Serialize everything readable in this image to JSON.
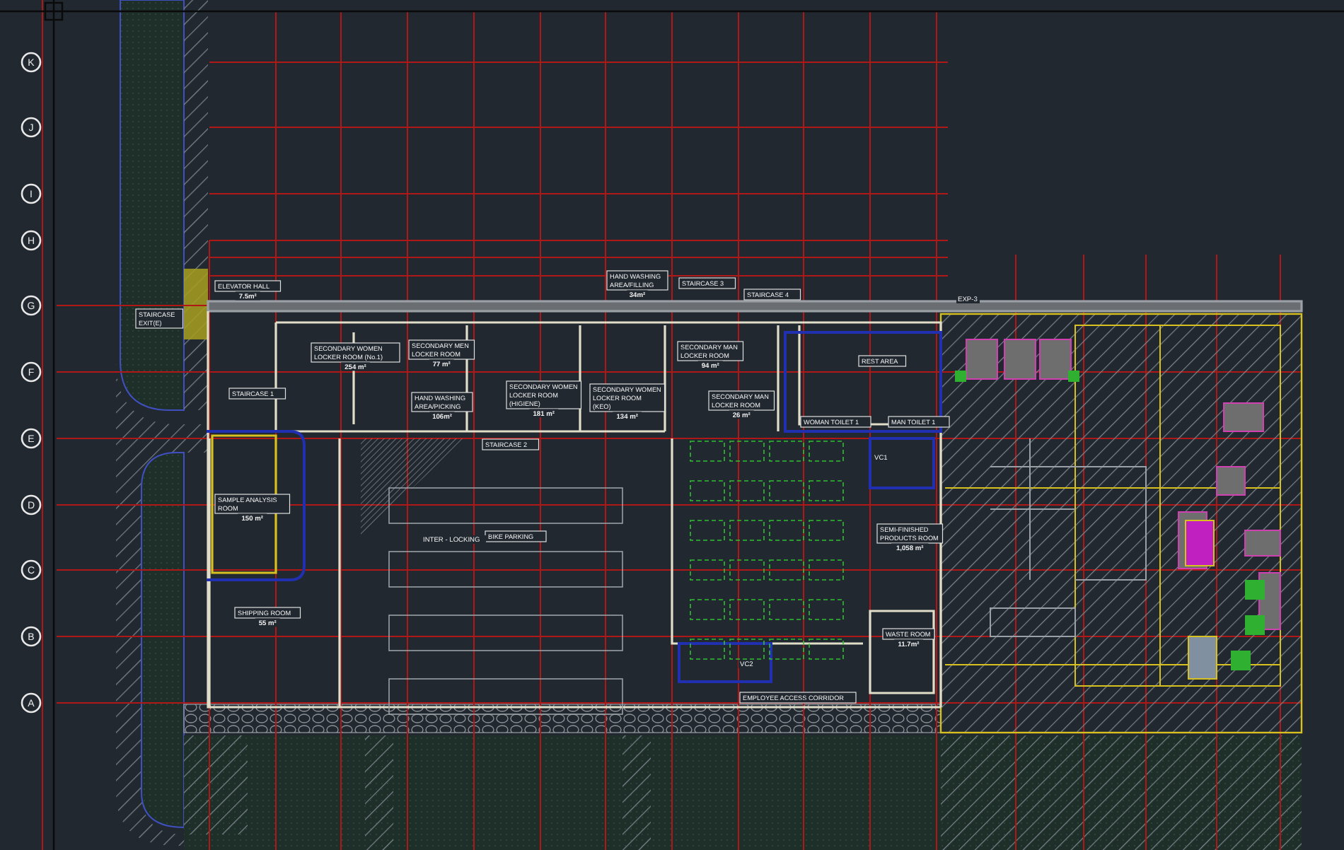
{
  "grid_bubbles": [
    {
      "label": "K"
    },
    {
      "label": "J"
    },
    {
      "label": "I"
    },
    {
      "label": "H"
    },
    {
      "label": "G"
    },
    {
      "label": "F"
    },
    {
      "label": "E"
    },
    {
      "label": "D"
    },
    {
      "label": "C"
    },
    {
      "label": "B"
    },
    {
      "label": "A"
    }
  ],
  "rooms": [
    {
      "lines": [
        "HAND WASHING",
        "AREA/FILLING"
      ],
      "area": "34m²"
    },
    {
      "lines": [
        "STAIRCASE 3"
      ]
    },
    {
      "lines": [
        "ELEVATOR HALL"
      ],
      "area": "7.5m²"
    },
    {
      "lines": [
        "STAIRCASE 4"
      ]
    },
    {
      "lines": [
        "STAIRCASE",
        "EXIT(E)"
      ]
    },
    {
      "lines": [
        "SECONDARY WOMEN",
        "LOCKER ROOM (No.1)"
      ],
      "area": "254 m²"
    },
    {
      "lines": [
        "SECONDARY MEN",
        "LOCKER ROOM"
      ],
      "area": "77 m²"
    },
    {
      "lines": [
        "SECONDARY MAN",
        "LOCKER ROOM"
      ],
      "area": "94 m²"
    },
    {
      "lines": [
        "REST AREA"
      ]
    },
    {
      "lines": [
        "STAIRCASE 1"
      ]
    },
    {
      "lines": [
        "HAND WASHING",
        "AREA/PICKING"
      ],
      "area": "106m²"
    },
    {
      "lines": [
        "SECONDARY WOMEN",
        "LOCKER ROOM",
        "(HIGIENE)"
      ],
      "area": "181 m²"
    },
    {
      "lines": [
        "SECONDARY WOMEN",
        "LOCKER ROOM",
        "(KEO)"
      ],
      "area": "134 m²"
    },
    {
      "lines": [
        "SECONDARY MAN",
        "LOCKER ROOM"
      ],
      "area": "26 m²"
    },
    {
      "lines": [
        "WOMAN TOILET 1"
      ]
    },
    {
      "lines": [
        "MAN TOILET 1"
      ]
    },
    {
      "lines": [
        "STAIRCASE 2"
      ]
    },
    {
      "lines": [
        "SAMPLE ANALYSIS",
        "ROOM"
      ],
      "area": "150 m²"
    },
    {
      "lines": [
        "BIKE PARKING"
      ]
    },
    {
      "lines": [
        "SEMI-FINISHED",
        "PRODUCTS ROOM"
      ],
      "area": "1,058 m²"
    },
    {
      "lines": [
        "SHIPPING ROOM"
      ],
      "area": "55 m²"
    },
    {
      "lines": [
        "WASTE ROOM"
      ],
      "area": "11.7m²"
    },
    {
      "lines": [
        "EMPLOYEE ACCESS CORRIDOR"
      ]
    }
  ],
  "notes": [
    {
      "text": "INTER - LOCKING"
    },
    {
      "text": "EXP-3"
    },
    {
      "text": "VC1"
    },
    {
      "text": "VC2"
    }
  ]
}
